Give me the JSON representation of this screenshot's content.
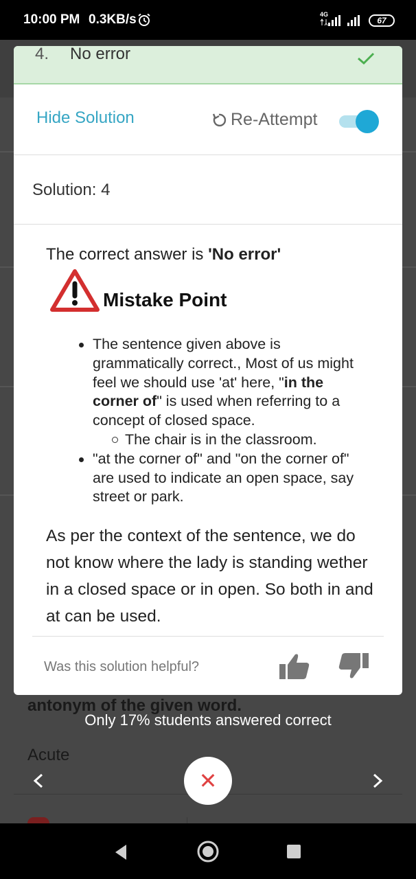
{
  "status_bar": {
    "time": "10:00 PM",
    "speed": "0.3KB/s",
    "network": "4G",
    "battery": "67"
  },
  "background": {
    "question_text": "antonym of the given word.",
    "option_text": "Acute"
  },
  "card": {
    "answer_number": "4.",
    "answer_text": "No error",
    "hide_solution_label": "Hide Solution",
    "reattempt_label": "Re-Attempt",
    "toggle_on": true,
    "solution_label": "Solution: 4",
    "correct_prefix": "The correct answer is ",
    "correct_answer": "'No error'",
    "mistake_title": "Mistake Point",
    "bullet1_a": "The sentence given above is grammatically correct., Most of us might feel we should use 'at' here, \"",
    "bullet1_bold": "in the corner of",
    "bullet1_b": "\" is used when referring to a concept of closed space.",
    "subbullet": "The chair is in the classroom.",
    "bullet2": "\"at the corner of\" and \"on the corner of\" are used to indicate an open space, say street or park.",
    "context_paragraph": "As per the context of the sentence, we do not know where the lady is standing wether in a closed space or in open. So both in and at can be used.",
    "helpful_question": "Was this solution helpful?"
  },
  "footer": {
    "stat_text": "Only 17% students answered correct"
  },
  "colors": {
    "accent_blue": "#36a6c4",
    "toggle_blue": "#1fa8d6",
    "correct_green": "#dcefdc",
    "check_green": "#4caf50",
    "close_red": "#e04343",
    "warning_red": "#d32f2f"
  },
  "icons": [
    "alarm-icon",
    "check-icon",
    "reattempt-icon",
    "warning-icon",
    "thumb-up-icon",
    "thumb-down-icon",
    "chevron-left-icon",
    "chevron-right-icon",
    "close-icon",
    "back-icon",
    "home-icon",
    "recent-icon"
  ]
}
